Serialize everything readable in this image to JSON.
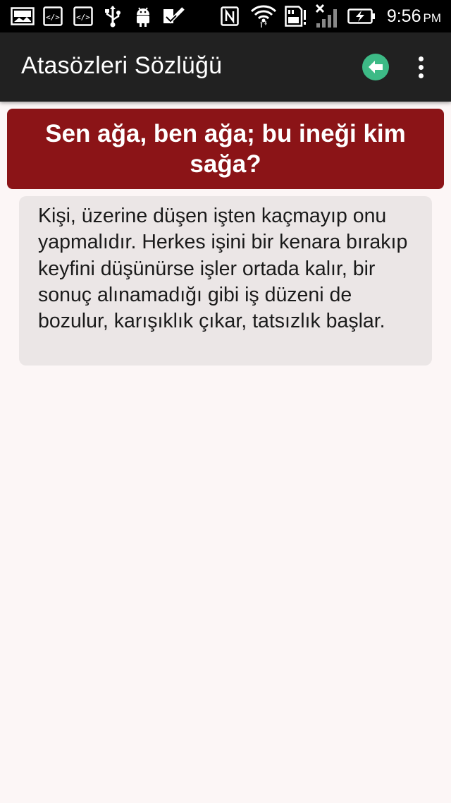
{
  "status_bar": {
    "time": "9:56",
    "ampm": "PM",
    "icons": [
      "image-notification-icon",
      "code-notification-icon",
      "code-notification-icon",
      "usb-icon",
      "android-debug-icon",
      "checklist-icon",
      "nfc-icon",
      "wifi-icon",
      "sd-card-alert-icon",
      "signal-no-service-icon",
      "battery-charging-icon"
    ]
  },
  "app_bar": {
    "title": "Atasözleri Sözlüğü",
    "back_icon": "arrow-left-circle-icon",
    "menu_icon": "more-vert-icon",
    "back_color": "#3dba86"
  },
  "proverb": {
    "text": "Sen ağa, ben ağa; bu ineği kim sağa?",
    "background": "#8b1417"
  },
  "meaning": {
    "text": "Kişi, üzerine düşen işten kaçmayıp onu yapmalıdır. Herkes işini bir kenara bırakıp keyfini düşünürse işler ortada kalır, bir sonuç alınamadığı gibi iş düzeni de bozulur, karışıklık çıkar, tatsızlık başlar."
  },
  "colors": {
    "page_background": "#fcf6f6",
    "app_bar": "#212121",
    "meaning_card": "#ebe6e6"
  }
}
